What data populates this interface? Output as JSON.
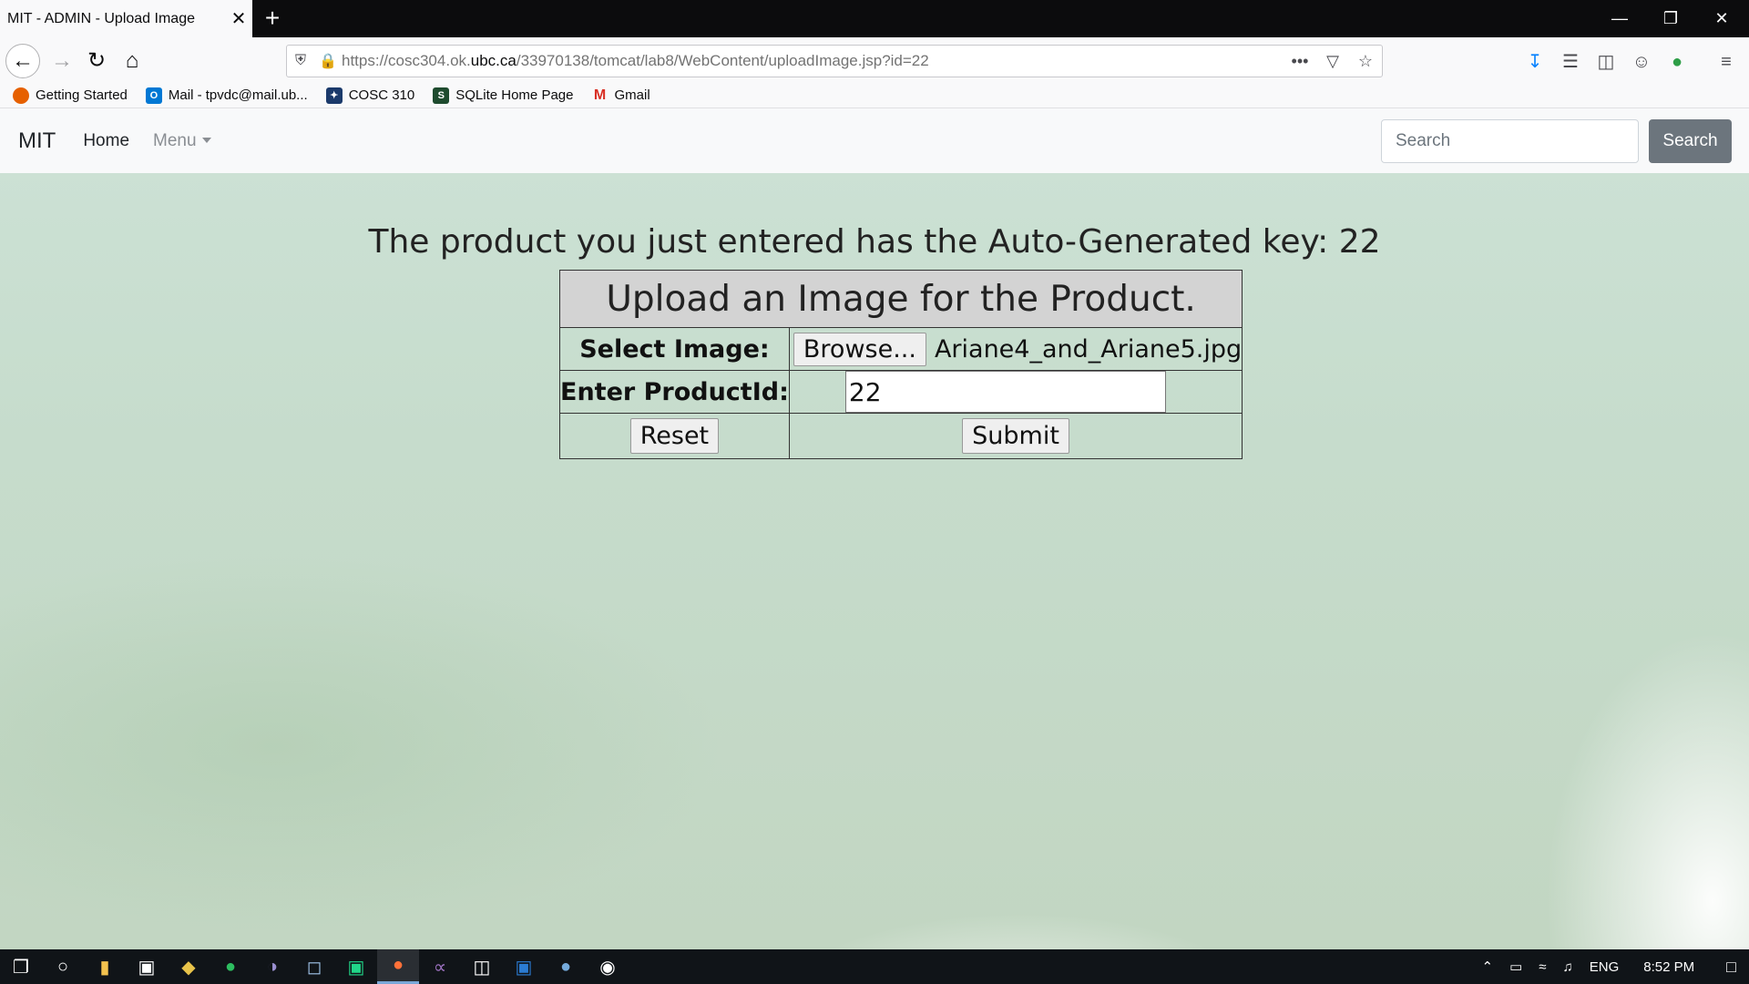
{
  "browser": {
    "tab_title": "MIT - ADMIN - Upload Image",
    "tab_close": "✕",
    "new_tab": "+",
    "url_prefix": "https://cosc304.ok.",
    "url_host": "ubc.ca",
    "url_path": "/33970138/tomcat/lab8/WebContent/uploadImage.jsp?id=22",
    "url_more": "•••",
    "window_controls": {
      "minimize": "—",
      "restore": "❐",
      "close": "✕"
    }
  },
  "bookmarks": [
    {
      "label": "Getting Started",
      "icon": "firefox-icon",
      "color": "#e66000",
      "glyph": "●"
    },
    {
      "label": "Mail - tpvdc@mail.ub...",
      "icon": "outlook-icon",
      "color": "#0078d4",
      "glyph": "O"
    },
    {
      "label": "COSC 310",
      "icon": "cosc-icon",
      "color": "#1b3a6b",
      "glyph": "✦"
    },
    {
      "label": "SQLite Home Page",
      "icon": "sqlite-icon",
      "color": "#1e4b2e",
      "glyph": "S"
    },
    {
      "label": "Gmail",
      "icon": "gmail-icon",
      "color": "#d93025",
      "glyph": "M"
    }
  ],
  "site_nav": {
    "brand": "MIT",
    "home": "Home",
    "menu": "Menu",
    "search_placeholder": "Search",
    "search_button": "Search"
  },
  "main": {
    "key_message": "The product you just entered has the Auto-Generated key: 22",
    "form": {
      "heading": "Upload an Image for the Product.",
      "select_image_label": "Select Image:",
      "browse_label": "Browse...",
      "file_name": "Ariane4_and_Ariane5.jpg",
      "product_id_label": "Enter ProductId:",
      "product_id_value": "22",
      "reset_label": "Reset",
      "submit_label": "Submit"
    }
  },
  "taskbar": {
    "icons": [
      "windows-start-icon",
      "cortana-icon",
      "file-explorer-icon",
      "photos-icon",
      "app-icon",
      "evernote-icon",
      "eclipse-icon",
      "virtualbox-icon",
      "pycharm-icon",
      "firefox-icon",
      "visual-studio-icon",
      "twitch-icon",
      "word-icon",
      "rstudio-icon",
      "app2-icon"
    ],
    "language": "ENG",
    "time": "8:52 PM"
  }
}
